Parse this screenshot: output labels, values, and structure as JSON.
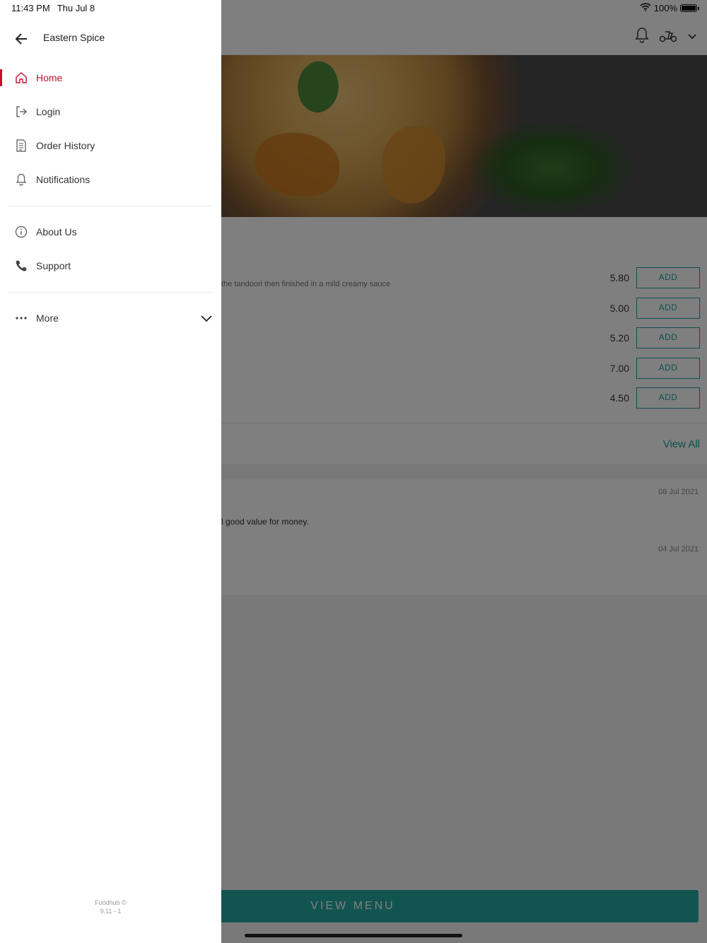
{
  "status_bar": {
    "time": "11:43 PM",
    "date": "Thu Jul 8",
    "battery": "100%"
  },
  "drawer": {
    "title": "Eastern Spice",
    "nav": [
      {
        "label": "Home",
        "icon": "home-icon",
        "active": true
      },
      {
        "label": "Login",
        "icon": "login-icon"
      },
      {
        "label": "Order History",
        "icon": "order-history-icon"
      },
      {
        "label": "Notifications",
        "icon": "bell-icon"
      }
    ],
    "nav2": [
      {
        "label": "About Us",
        "icon": "info-icon"
      },
      {
        "label": "Support",
        "icon": "phone-icon"
      }
    ],
    "more": {
      "label": "More",
      "icon": "ellipsis-icon"
    },
    "footer": {
      "brand": "Foodhub ©",
      "version": "9.11 - 1"
    }
  },
  "background": {
    "menu_items": [
      {
        "description": "the tandoori then finished in a mild creamy sauce",
        "price": "5.80",
        "button": "ADD"
      },
      {
        "price": "5.00",
        "button": "ADD"
      },
      {
        "price": "5.20",
        "button": "ADD"
      },
      {
        "price": "7.00",
        "button": "ADD"
      },
      {
        "price": "4.50",
        "button": "ADD"
      }
    ],
    "reviews": {
      "view_all": "View All",
      "items": [
        {
          "date": "08 Jul 2021",
          "text": "l good value for money."
        },
        {
          "date": "04 Jul 2021"
        }
      ]
    },
    "view_menu": "VIEW MENU"
  },
  "colors": {
    "accent": "#c8102e",
    "teal": "#24a9a1"
  }
}
